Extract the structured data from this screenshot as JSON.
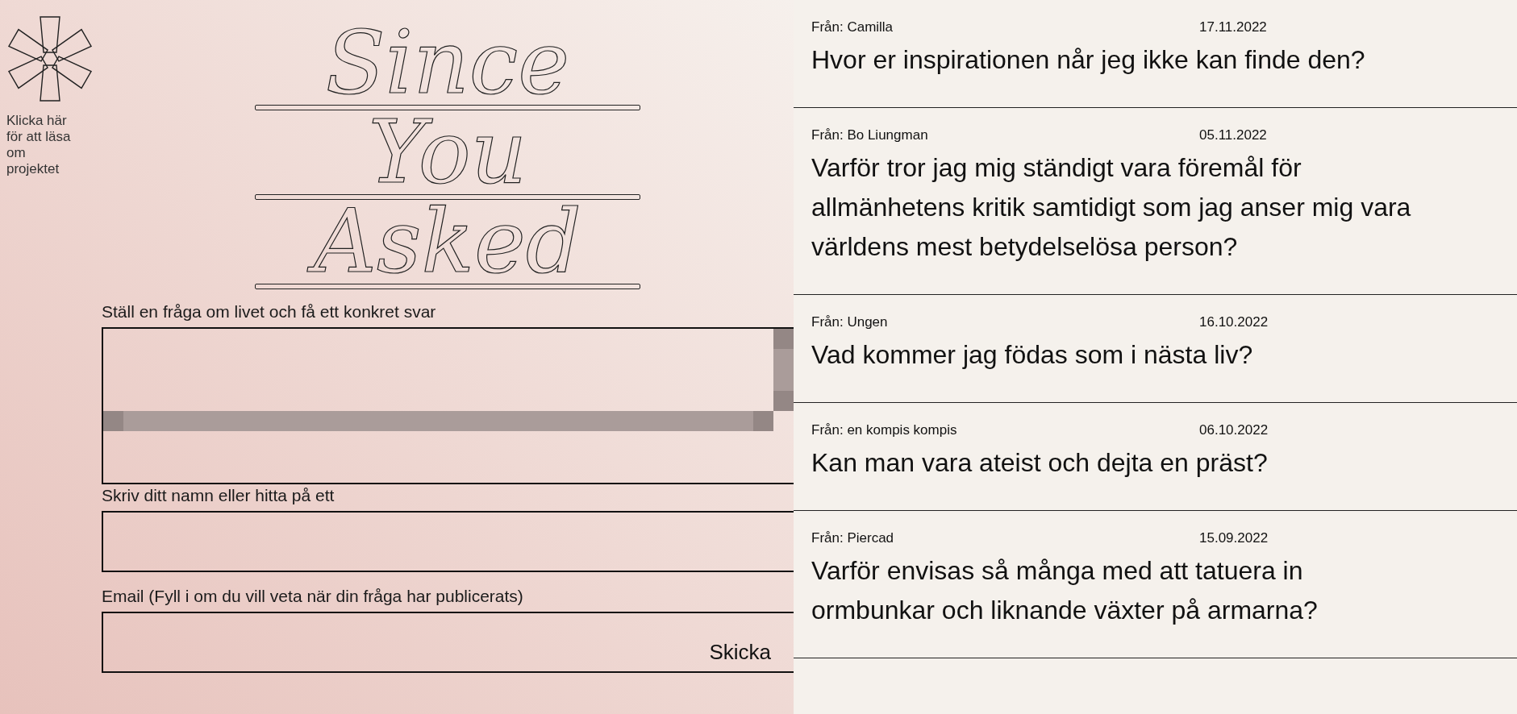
{
  "about_link": {
    "label": "Klicka här för att läsa om projektet"
  },
  "logo": {
    "lines": [
      "Since",
      "You",
      "Asked"
    ]
  },
  "form": {
    "fields": [
      {
        "kind": "textarea",
        "label": "Ställ en fråga om livet och få ett konkret svar"
      },
      {
        "kind": "input",
        "label": "Skriv ditt namn eller hitta på ett"
      },
      {
        "kind": "input",
        "label": "Email (Fyll i om du vill veta när din fråga har publicerats)"
      }
    ],
    "submit": "Skicka"
  },
  "questions": [
    {
      "from": "Från: Camilla",
      "date": "17.11.2022",
      "title": "Hvor er inspirationen når jeg ikke kan finde den?"
    },
    {
      "from": "Från: Bo Liungman",
      "date": "05.11.2022",
      "title": "Varför tror jag mig ständigt vara föremål för allmänhetens kritik samtidigt som jag anser mig vara världens mest betydelselösa person?"
    },
    {
      "from": "Från: Ungen",
      "date": "16.10.2022",
      "title": "Vad kommer jag födas som i nästa liv?"
    },
    {
      "from": "Från: en kompis kompis",
      "date": "06.10.2022",
      "title": "Kan man vara ateist och dejta en präst?"
    },
    {
      "from": "Från: Piercad",
      "date": "15.09.2022",
      "title": "Varför envisas så många med att tatuera in ormbunkar och liknande växter på armarna?"
    }
  ]
}
